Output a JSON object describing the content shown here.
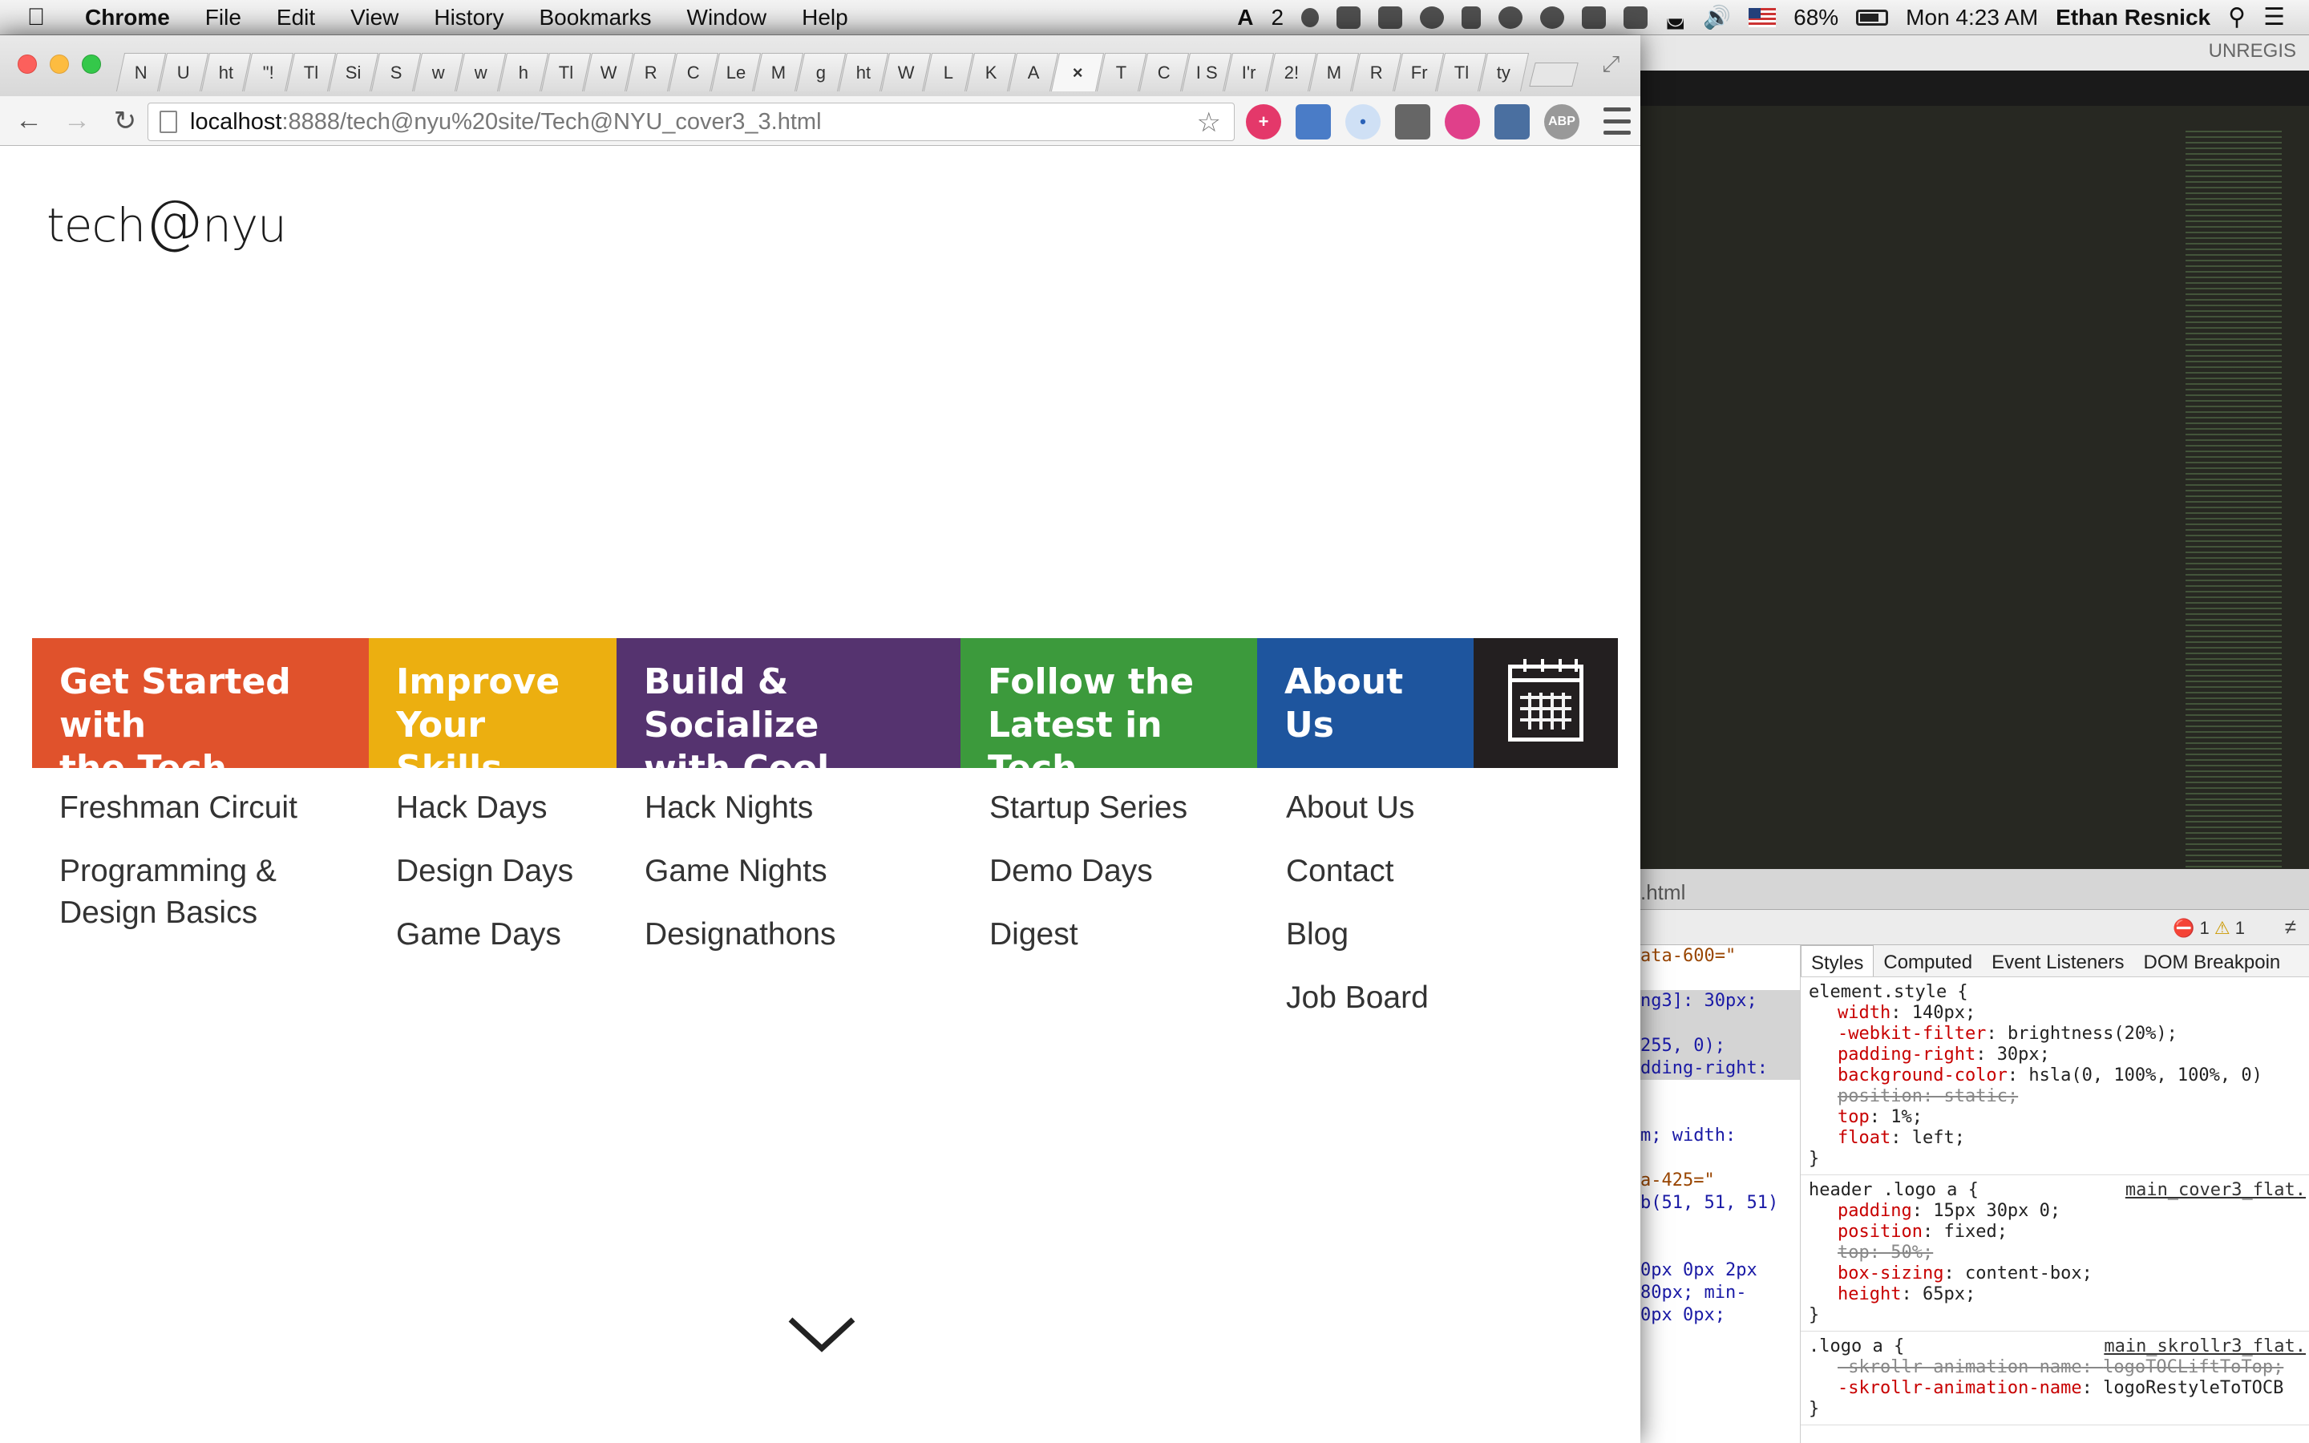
{
  "menubar": {
    "app": "Chrome",
    "menus": [
      "File",
      "Edit",
      "View",
      "History",
      "Bookmarks",
      "Window",
      "Help"
    ],
    "notifications_count": "2",
    "battery": "68%",
    "clock": "Mon 4:23 AM",
    "user": "Ethan Resnick"
  },
  "browser": {
    "tabs": [
      "N",
      "U",
      "ht",
      "\"!",
      "Tl",
      "Si",
      "S",
      "w",
      "w",
      "h",
      "Tl",
      "W",
      "R",
      "C",
      "Le",
      "M",
      "g",
      "ht",
      "W",
      "L",
      "K",
      "A",
      "×",
      "T",
      "C",
      "I S",
      "I'r",
      "2!",
      "M",
      "R",
      "Fr",
      "Tl",
      "ty"
    ],
    "url_host": "localhost",
    "url_path": ":8888/tech@nyu%20site/Tech@NYU_cover3_3.html",
    "extensions": [
      "+",
      "",
      "•",
      "",
      "",
      "",
      "ABP"
    ]
  },
  "page": {
    "logo_text": "tech",
    "logo_at": "@",
    "logo_suffix": "nyu",
    "nav": [
      {
        "title_line1": "Get Started with",
        "title_line2": "the Tech Scene",
        "color": "#e0522c",
        "items": [
          "Freshman Circuit",
          "Programming & Design Basics"
        ]
      },
      {
        "title_line1": "Improve",
        "title_line2": "Your Skills",
        "color": "#ecaf10",
        "items": [
          "Hack Days",
          "Design Days",
          "Game Days"
        ]
      },
      {
        "title_line1": "Build & Socialize",
        "title_line2": "with Cool People",
        "color": "#55336f",
        "items": [
          "Hack Nights",
          "Game Nights",
          "Designathons"
        ]
      },
      {
        "title_line1": "Follow the",
        "title_line2": "Latest in Tech",
        "color": "#3c9a3c",
        "items": [
          "Startup Series",
          "Demo Days",
          "Digest"
        ]
      },
      {
        "title_line1": "About Us",
        "title_line2": "",
        "color": "#1e559e",
        "items": [
          "About Us",
          "Contact",
          "Blog",
          "Job Board"
        ]
      }
    ],
    "calendar_icon": "calendar-icon",
    "scroll_icon": "chevron-down-icon"
  },
  "editor": {
    "unregistered_label": "UNREGIS",
    "filename": ".html"
  },
  "devtools": {
    "errors": "1",
    "warnings": "1",
    "elements_lines": [
      {
        "text": "ata-600=\"",
        "hl": false,
        "attr": true
      },
      {
        "text": "",
        "hl": false,
        "attr": false
      },
      {
        "text": "ng3]: 30px;",
        "hl": true,
        "attr": false
      },
      {
        "text": "",
        "hl": true,
        "attr": false
      },
      {
        "text": "255, 0);",
        "hl": true,
        "attr": false
      },
      {
        "text": "dding-right:",
        "hl": true,
        "attr": false
      },
      {
        "text": "",
        "hl": false,
        "attr": false
      },
      {
        "text": "",
        "hl": false,
        "attr": false
      },
      {
        "text": "m;    width:",
        "hl": false,
        "attr": false
      },
      {
        "text": "",
        "hl": false,
        "attr": false
      },
      {
        "text": "a-425=\"",
        "hl": false,
        "attr": true
      },
      {
        "text": "b(51, 51, 51)",
        "hl": false,
        "attr": false
      },
      {
        "text": "",
        "hl": false,
        "attr": false
      },
      {
        "text": "",
        "hl": false,
        "attr": false
      },
      {
        "text": "0px 0px 2px",
        "hl": false,
        "attr": false
      },
      {
        "text": " 80px; min-",
        "hl": false,
        "attr": false
      },
      {
        "text": "0px 0px;",
        "hl": false,
        "attr": false
      }
    ],
    "style_tabs": [
      "Styles",
      "Computed",
      "Event Listeners",
      "DOM Breakpoin"
    ],
    "rules": [
      {
        "selector": "element.style {",
        "source": "",
        "decls": [
          {
            "prop": "width",
            "value": "140px;",
            "struck": false
          },
          {
            "prop": "-webkit-filter",
            "value": "brightness(20%);",
            "struck": false
          },
          {
            "prop": "padding-right",
            "value": "30px;",
            "struck": false
          },
          {
            "prop": "background-color",
            "value": "hsla(0, 100%, 100%, 0)",
            "struck": false
          },
          {
            "prop": "position",
            "value": "static;",
            "struck": true
          },
          {
            "prop": "top",
            "value": "1%;",
            "struck": false
          },
          {
            "prop": "float",
            "value": "left;",
            "struck": false
          }
        ]
      },
      {
        "selector": "header .logo a {",
        "source": "main_cover3_flat.",
        "decls": [
          {
            "prop": "padding",
            "value": "15px 30px 0;",
            "struck": false
          },
          {
            "prop": "position",
            "value": "fixed;",
            "struck": false
          },
          {
            "prop": "top",
            "value": "50%;",
            "struck": true
          },
          {
            "prop": "box-sizing",
            "value": "content-box;",
            "struck": false
          },
          {
            "prop": "height",
            "value": "65px;",
            "struck": false
          }
        ]
      },
      {
        "selector": ".logo a {",
        "source": "main_skrollr3_flat.",
        "decls": [
          {
            "prop": "-skrollr-animation-name",
            "value": "logoTOCLiftToTop;",
            "struck": true
          },
          {
            "prop": "-skrollr-animation-name",
            "value": "logoRestyleToTOCB",
            "struck": false
          }
        ]
      }
    ]
  }
}
